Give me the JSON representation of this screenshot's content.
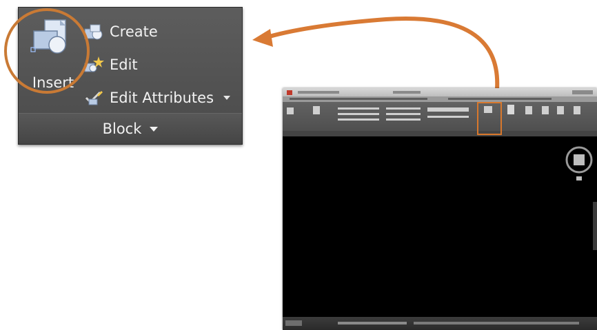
{
  "panel": {
    "insert_label": "Insert",
    "items": [
      {
        "label": "Create",
        "icon": "create-block-icon"
      },
      {
        "label": "Edit",
        "icon": "edit-block-icon"
      },
      {
        "label": "Edit Attributes",
        "icon": "edit-attributes-icon",
        "has_dropdown": true
      }
    ],
    "title": "Block"
  },
  "colors": {
    "highlight": "#c97a35",
    "panel_bg": "#4f4f4f",
    "panel_text": "#f2f2f2",
    "canvas_bg": "#000000"
  }
}
